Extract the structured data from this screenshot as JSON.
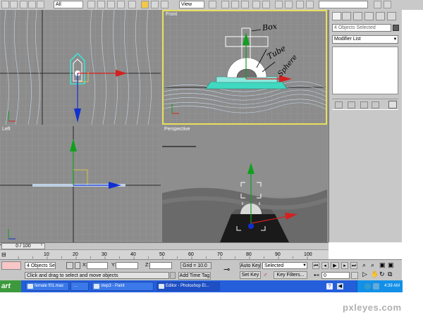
{
  "toolbar": {
    "selection_filter": "All",
    "ref_coord": "View"
  },
  "viewports": {
    "top_label": "",
    "front_label": "Front",
    "left_label": "Left",
    "perspective_label": "Perspective"
  },
  "annotations": {
    "box": "Box",
    "tube": "Tube",
    "sphere": "Sphere"
  },
  "command_panel": {
    "name_field": "4 Objects Selected",
    "modifier_list": "Modifier List"
  },
  "timeline": {
    "frame_readout": "0 / 100",
    "ticks": [
      "10",
      "20",
      "30",
      "40",
      "50",
      "60",
      "70",
      "80",
      "90",
      "100"
    ]
  },
  "status": {
    "selection_info": "4 Objects Sele",
    "x_label": "X:",
    "y_label": "Y:",
    "z_label": "Z:",
    "grid": "Grid = 10.0",
    "prompt": "Click and drag to select and move objects",
    "add_time_tag": "Add Time Tag",
    "auto_key": "Auto Key",
    "auto_key_value": "Selected",
    "set_key": "Set Key",
    "key_filters": "Key Filters...",
    "frame": "0"
  },
  "taskbar": {
    "start": "art",
    "tasks": [
      "female f01.max",
      "...",
      "step3 - Paint",
      "Editor - Photoshop El...",
      "..."
    ],
    "clock": "4:39 AM"
  },
  "watermark": "pxleyes.com",
  "colors": {
    "active_border": "#e8e05a",
    "axis_x": "#d42020",
    "axis_y": "#10a020",
    "axis_z": "#1030d0",
    "taskbar": "#245edb"
  }
}
